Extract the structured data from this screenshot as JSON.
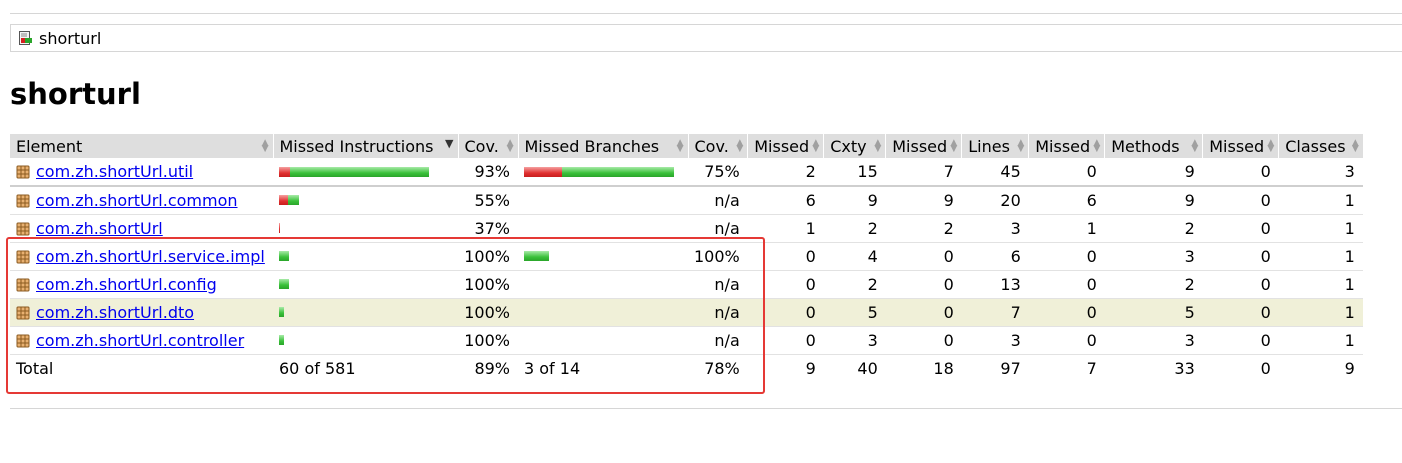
{
  "breadcrumb": {
    "label": "shorturl",
    "icon": "report-icon"
  },
  "page_title": "shorturl",
  "table": {
    "headers": [
      "Element",
      "Missed Instructions",
      "Cov.",
      "Missed Branches",
      "Cov.",
      "Missed",
      "Cxty",
      "Missed",
      "Lines",
      "Missed",
      "Methods",
      "Missed",
      "Classes"
    ],
    "rows": [
      {
        "element": "com.zh.shortUrl.util",
        "instr_missed_frac": 0.07,
        "instr_cov": "93%",
        "branch_missed_frac": 0.25,
        "branch_cov": "75%",
        "cxty_missed": "2",
        "cxty": "15",
        "lines_missed": "7",
        "lines": "45",
        "methods_missed": "0",
        "methods": "9",
        "classes_missed": "0",
        "classes": "3"
      },
      {
        "element": "com.zh.shortUrl.common",
        "instr_missed_frac": 0.45,
        "instr_cov": "55%",
        "branch_cov": "n/a",
        "cxty_missed": "6",
        "cxty": "9",
        "lines_missed": "9",
        "lines": "20",
        "methods_missed": "6",
        "methods": "9",
        "classes_missed": "0",
        "classes": "1"
      },
      {
        "element": "com.zh.shortUrl",
        "instr_missed_frac": 0.63,
        "instr_cov": "37%",
        "branch_cov": "n/a",
        "cxty_missed": "1",
        "cxty": "2",
        "lines_missed": "2",
        "lines": "3",
        "methods_missed": "1",
        "methods": "2",
        "classes_missed": "0",
        "classes": "1"
      },
      {
        "element": "com.zh.shortUrl.service.impl",
        "instr_missed_frac": 0.0,
        "instr_cov": "100%",
        "branch_missed_frac": 0.0,
        "branch_cov": "100%",
        "cxty_missed": "0",
        "cxty": "4",
        "lines_missed": "0",
        "lines": "6",
        "methods_missed": "0",
        "methods": "3",
        "classes_missed": "0",
        "classes": "1"
      },
      {
        "element": "com.zh.shortUrl.config",
        "instr_missed_frac": 0.0,
        "instr_cov": "100%",
        "branch_cov": "n/a",
        "cxty_missed": "0",
        "cxty": "2",
        "lines_missed": "0",
        "lines": "13",
        "methods_missed": "0",
        "methods": "2",
        "classes_missed": "0",
        "classes": "1"
      },
      {
        "element": "com.zh.shortUrl.dto",
        "instr_missed_frac": 0.0,
        "instr_cov": "100%",
        "branch_cov": "n/a",
        "cxty_missed": "0",
        "cxty": "5",
        "lines_missed": "0",
        "lines": "7",
        "methods_missed": "0",
        "methods": "5",
        "classes_missed": "0",
        "classes": "1"
      },
      {
        "element": "com.zh.shortUrl.controller",
        "instr_missed_frac": 0.0,
        "instr_cov": "100%",
        "branch_cov": "n/a",
        "cxty_missed": "0",
        "cxty": "3",
        "lines_missed": "0",
        "lines": "3",
        "methods_missed": "0",
        "methods": "3",
        "classes_missed": "0",
        "classes": "1"
      }
    ],
    "total": {
      "label": "Total",
      "instr": "60 of 581",
      "instr_cov": "89%",
      "branch": "3 of 14",
      "branch_cov": "78%",
      "cxty_missed": "9",
      "cxty": "40",
      "lines_missed": "18",
      "lines": "97",
      "methods_missed": "7",
      "methods": "33",
      "classes_missed": "0",
      "classes": "9"
    }
  },
  "colors": {
    "covered": "#3ac03a",
    "missed": "#e03030",
    "highlight": "#f0f0d8",
    "annotation_box": "#e53935"
  }
}
